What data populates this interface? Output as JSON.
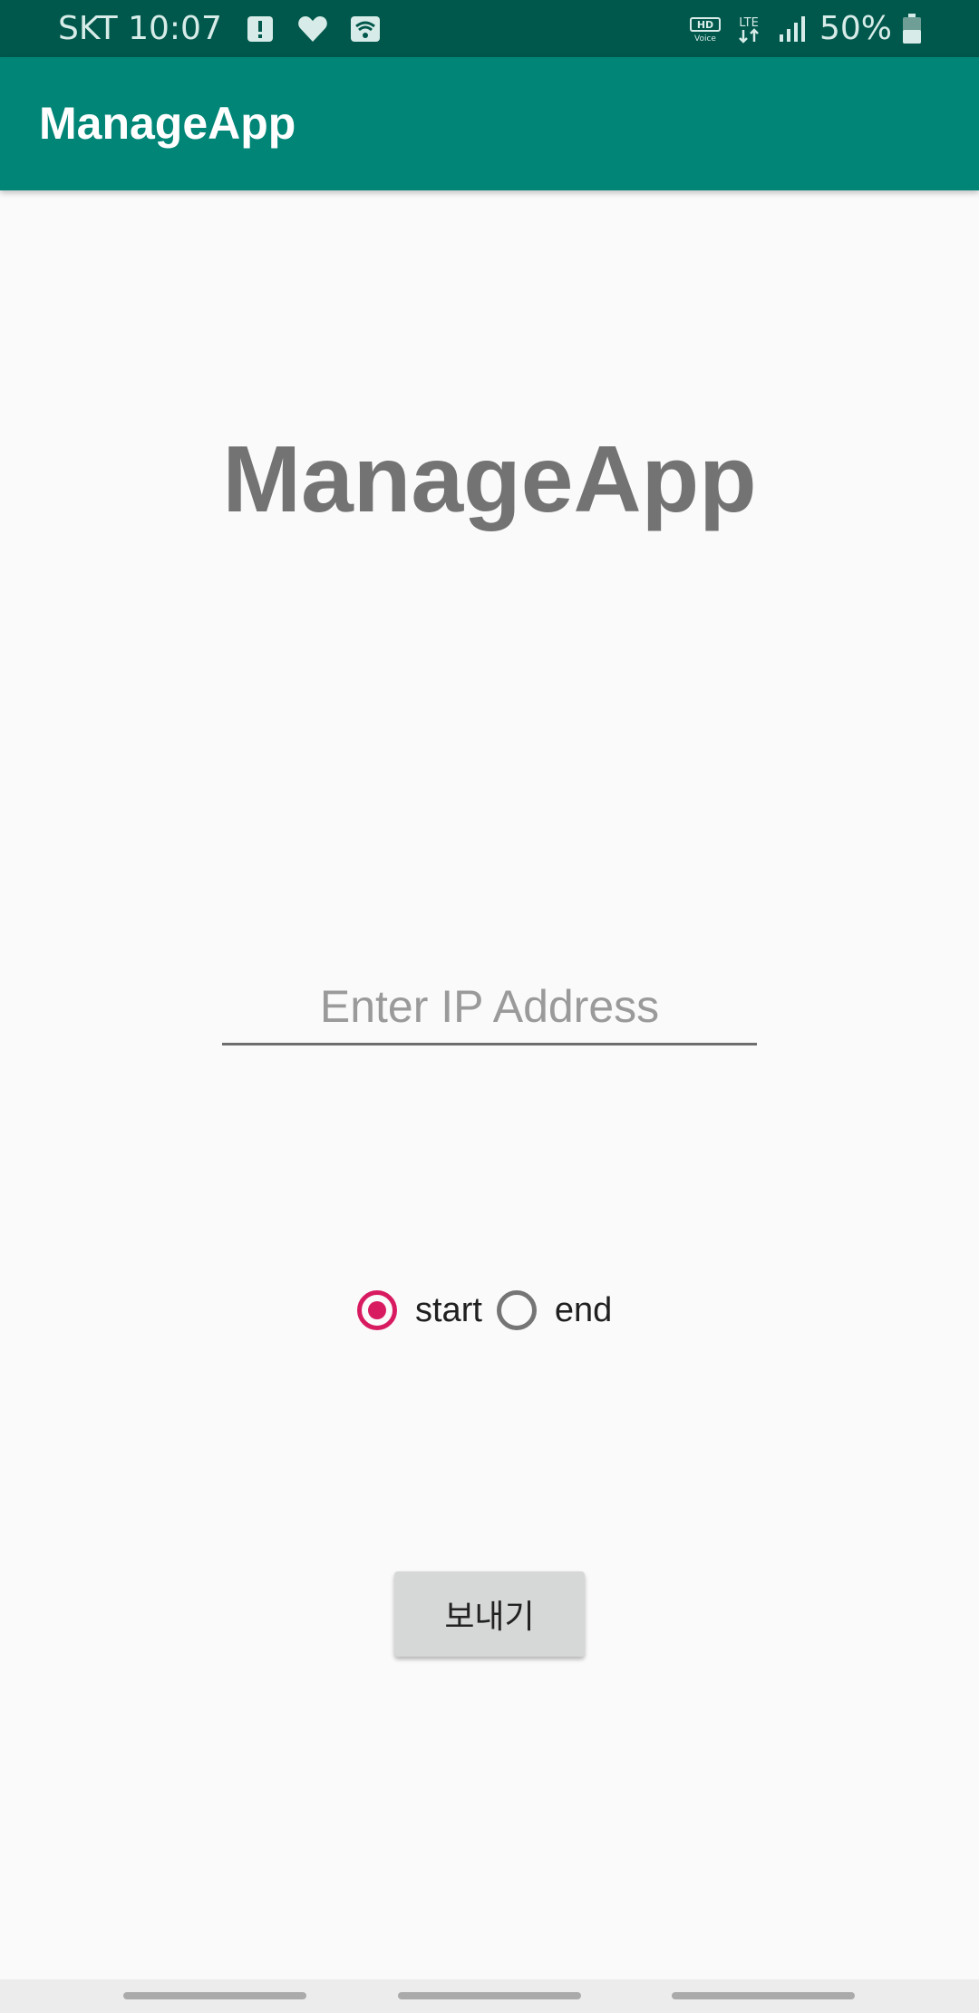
{
  "status_bar": {
    "carrier": "SKT",
    "time": "10:07",
    "network": "LTE",
    "battery": "50%"
  },
  "app_bar": {
    "title": "ManageApp"
  },
  "main": {
    "heading": "ManageApp",
    "ip_input": {
      "value": "",
      "placeholder": "Enter IP Address"
    },
    "radio_options": [
      {
        "label": "start",
        "checked": true
      },
      {
        "label": "end",
        "checked": false
      }
    ],
    "send_button_label": "보내기"
  },
  "colors": {
    "status_bar_bg": "#00574b",
    "app_bar_bg": "#008577",
    "accent": "#d81b60",
    "background": "#fafafa"
  },
  "icons": [
    "alert-icon",
    "heart-icon",
    "wifi-icon",
    "hd-voice-icon",
    "lte-icon",
    "signal-icon",
    "battery-icon"
  ]
}
